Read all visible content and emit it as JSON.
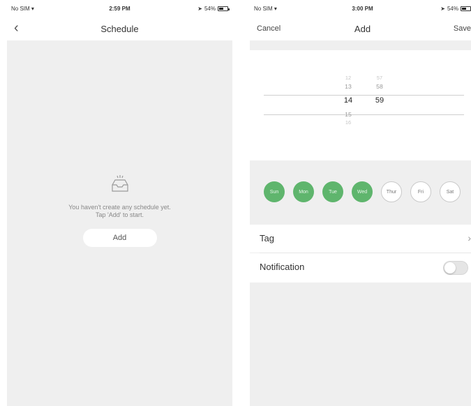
{
  "left": {
    "status": {
      "carrier": "No SIM",
      "time": "2:59 PM",
      "battery": "54%",
      "battery_level": 0.54
    },
    "nav": {
      "title": "Schedule",
      "back_icon": "back-arrow-icon"
    },
    "empty": {
      "line1": "You haven't create any schedule yet.",
      "line2": "Tap 'Add' to start.",
      "add_label": "Add",
      "icon": "empty-inbox-icon"
    }
  },
  "right": {
    "status": {
      "carrier": "No SIM",
      "time": "3:00 PM",
      "battery": "54%",
      "battery_level": 0.54
    },
    "nav": {
      "cancel": "Cancel",
      "title": "Add",
      "save": "Save"
    },
    "picker": {
      "hours": [
        "12",
        "13",
        "14",
        "15",
        "16"
      ],
      "minutes": [
        "57",
        "58",
        "59"
      ],
      "selected_hour": "14",
      "selected_minute": "59"
    },
    "days": [
      {
        "label": "Sun",
        "selected": true
      },
      {
        "label": "Mon",
        "selected": true
      },
      {
        "label": "Tue",
        "selected": true
      },
      {
        "label": "Wed",
        "selected": true
      },
      {
        "label": "Thur",
        "selected": false
      },
      {
        "label": "Fri",
        "selected": false
      },
      {
        "label": "Sat",
        "selected": false
      }
    ],
    "tag_label": "Tag",
    "notification_label": "Notification",
    "notification_on": false,
    "accent": "#5fb56d"
  }
}
